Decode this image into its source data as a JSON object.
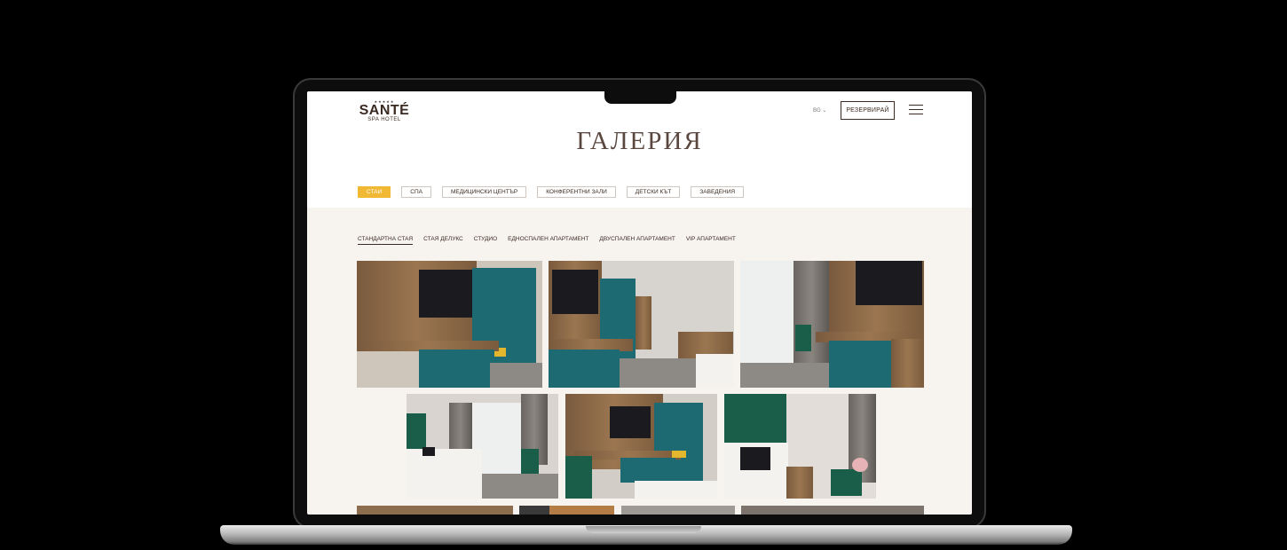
{
  "brand": {
    "stars": "★★★★★",
    "name": "SANTÉ",
    "subtitle": "SPA HOTEL"
  },
  "header": {
    "lang": "BG ⌄",
    "reserve_label": "РЕЗЕРВИРАЙ"
  },
  "page": {
    "title": "ГАЛЕРИЯ"
  },
  "categories": [
    {
      "label": "СТАИ",
      "active": true
    },
    {
      "label": "СПА",
      "active": false
    },
    {
      "label": "МЕДИЦИНСКИ ЦЕНТЪР",
      "active": false
    },
    {
      "label": "КОНФЕРЕНТНИ ЗАЛИ",
      "active": false
    },
    {
      "label": "ДЕТСКИ КЪТ",
      "active": false
    },
    {
      "label": "ЗАВЕДЕНИЯ",
      "active": false
    }
  ],
  "room_types": [
    {
      "label": "СТАНДАРТНА СТАЯ",
      "active": true
    },
    {
      "label": "СТАЯ ДЕЛУКС",
      "active": false
    },
    {
      "label": "СТУДИО",
      "active": false
    },
    {
      "label": "ЕДНОСПАЛЕН АПАРТАМЕНТ",
      "active": false
    },
    {
      "label": "ДВУСПАЛЕН АПАРТАМЕНТ",
      "active": false
    },
    {
      "label": "VIP АПАРТАМЕНТ",
      "active": false
    }
  ],
  "colors": {
    "accent": "#f0b833",
    "brand_text": "#3b2b22",
    "background": "#f7f3ee"
  }
}
